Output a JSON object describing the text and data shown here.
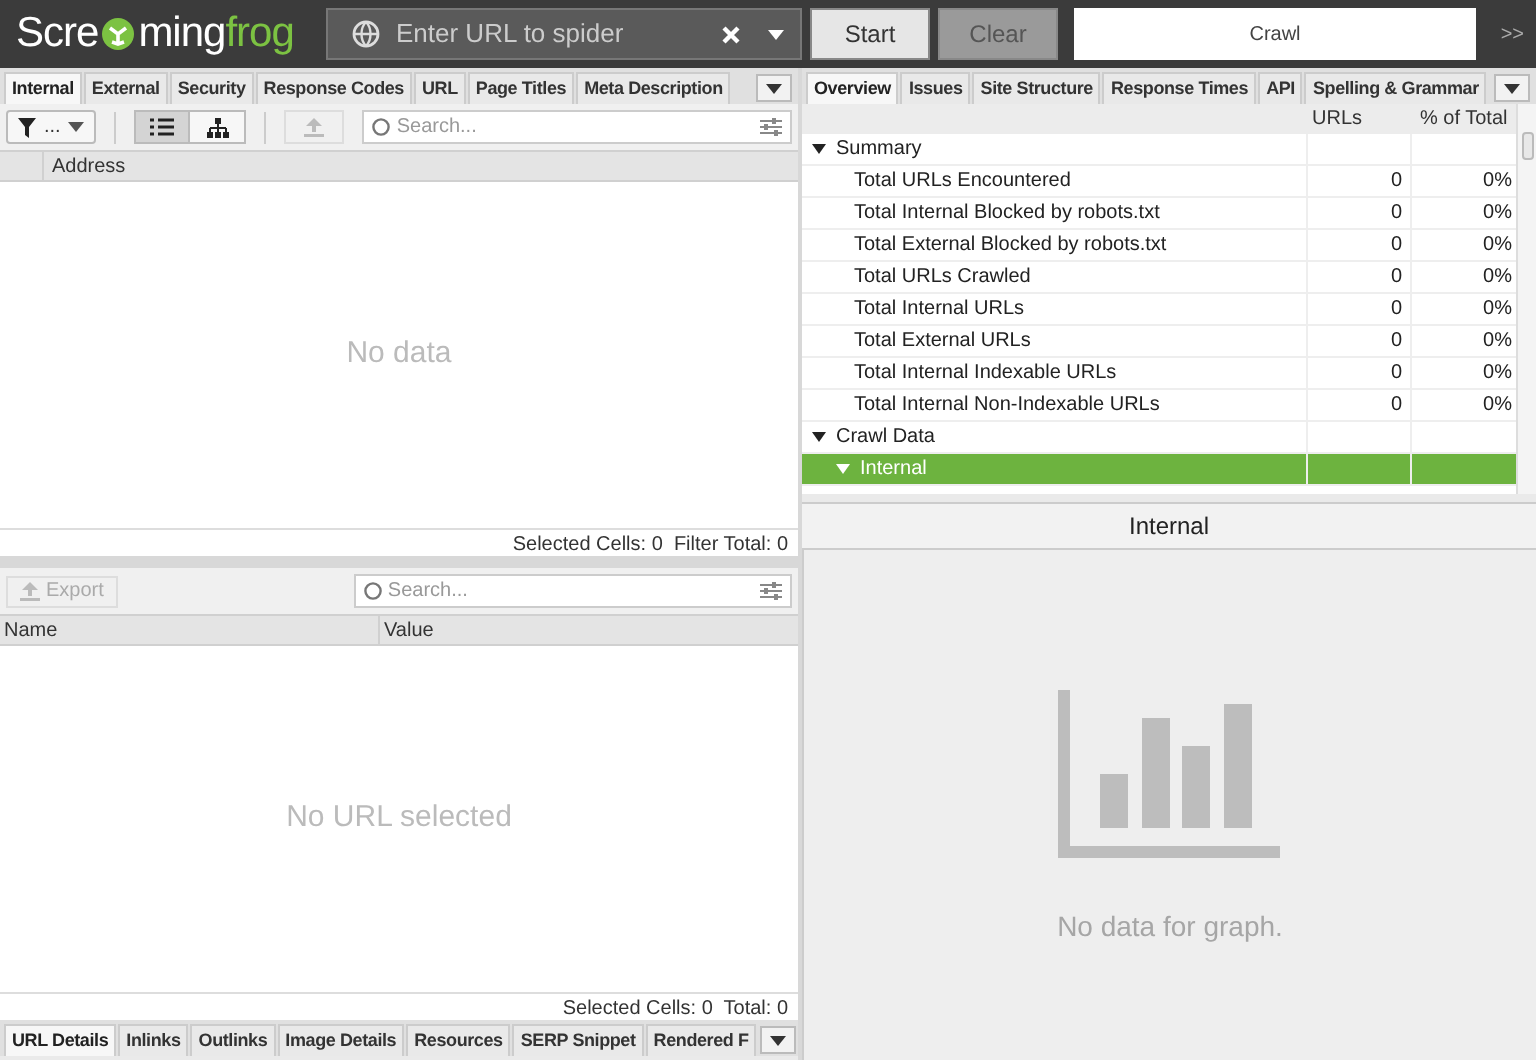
{
  "logo": {
    "parts": [
      "Scre",
      "ming",
      "frog"
    ]
  },
  "url_field": {
    "placeholder": "Enter URL to spider"
  },
  "buttons": [
    {
      "label": "Start",
      "disabled": false
    },
    {
      "label": "Clear",
      "disabled": true
    }
  ],
  "mode_field": {
    "value": "Crawl"
  },
  "more_button": ">>",
  "left_tabs": [
    {
      "label": "Internal",
      "selected": true
    },
    {
      "label": "External",
      "selected": false
    },
    {
      "label": "Security",
      "selected": false
    },
    {
      "label": "Response Codes",
      "selected": false
    },
    {
      "label": "URL",
      "selected": false
    },
    {
      "label": "Page Titles",
      "selected": false
    },
    {
      "label": "Meta Description",
      "selected": false
    }
  ],
  "filter_button": "...",
  "list_view": {
    "selected": true
  },
  "tree_view": {
    "selected": false
  },
  "top_search": {
    "placeholder": "Search..."
  },
  "top_table": {
    "columns": [
      "Address"
    ],
    "empty_text": "No data",
    "status": "Selected Cells: 0  Filter Total: 0"
  },
  "export_button": {
    "label": "Export",
    "disabled": true
  },
  "bottom_search": {
    "placeholder": "Search..."
  },
  "details_table": {
    "columns": [
      "Name",
      "Value"
    ],
    "empty_text": "No URL selected",
    "status": "Selected Cells: 0  Total: 0"
  },
  "bottom_tabs": [
    {
      "label": "URL Details",
      "selected": true
    },
    {
      "label": "Inlinks",
      "selected": false
    },
    {
      "label": "Outlinks",
      "selected": false
    },
    {
      "label": "Image Details",
      "selected": false
    },
    {
      "label": "Resources",
      "selected": false
    },
    {
      "label": "SERP Snippet",
      "selected": false
    },
    {
      "label": "Rendered F",
      "selected": false
    }
  ],
  "right_tabs": [
    {
      "label": "Overview",
      "selected": true
    },
    {
      "label": "Issues",
      "selected": false
    },
    {
      "label": "Site Structure",
      "selected": false
    },
    {
      "label": "Response Times",
      "selected": false
    },
    {
      "label": "API",
      "selected": false
    },
    {
      "label": "Spelling & Grammar",
      "selected": false
    }
  ],
  "overview": {
    "columns": [
      "URLs",
      "% of Total"
    ],
    "rows": [
      {
        "label": "Summary",
        "expanded": true,
        "selected": false,
        "children": [
          {
            "label": "Total URLs Encountered",
            "urls": "0",
            "percent": "0%",
            "selected": false
          },
          {
            "label": "Total Internal Blocked by robots.txt",
            "urls": "0",
            "percent": "0%",
            "selected": false
          },
          {
            "label": "Total External Blocked by robots.txt",
            "urls": "0",
            "percent": "0%",
            "selected": false
          },
          {
            "label": "Total URLs Crawled",
            "urls": "0",
            "percent": "0%",
            "selected": false
          },
          {
            "label": "Total Internal URLs",
            "urls": "0",
            "percent": "0%",
            "selected": false
          },
          {
            "label": "Total External URLs",
            "urls": "0",
            "percent": "0%",
            "selected": false
          },
          {
            "label": "Total Internal Indexable URLs",
            "urls": "0",
            "percent": "0%",
            "selected": false
          },
          {
            "label": "Total Internal Non-Indexable URLs",
            "urls": "0",
            "percent": "0%",
            "selected": false
          }
        ]
      },
      {
        "label": "Crawl Data",
        "expanded": true,
        "selected": false,
        "children": [
          {
            "label": "Internal",
            "expanded": true,
            "selected": true
          }
        ]
      }
    ]
  },
  "graph": {
    "title": "Internal",
    "empty_text": "No data for graph."
  }
}
